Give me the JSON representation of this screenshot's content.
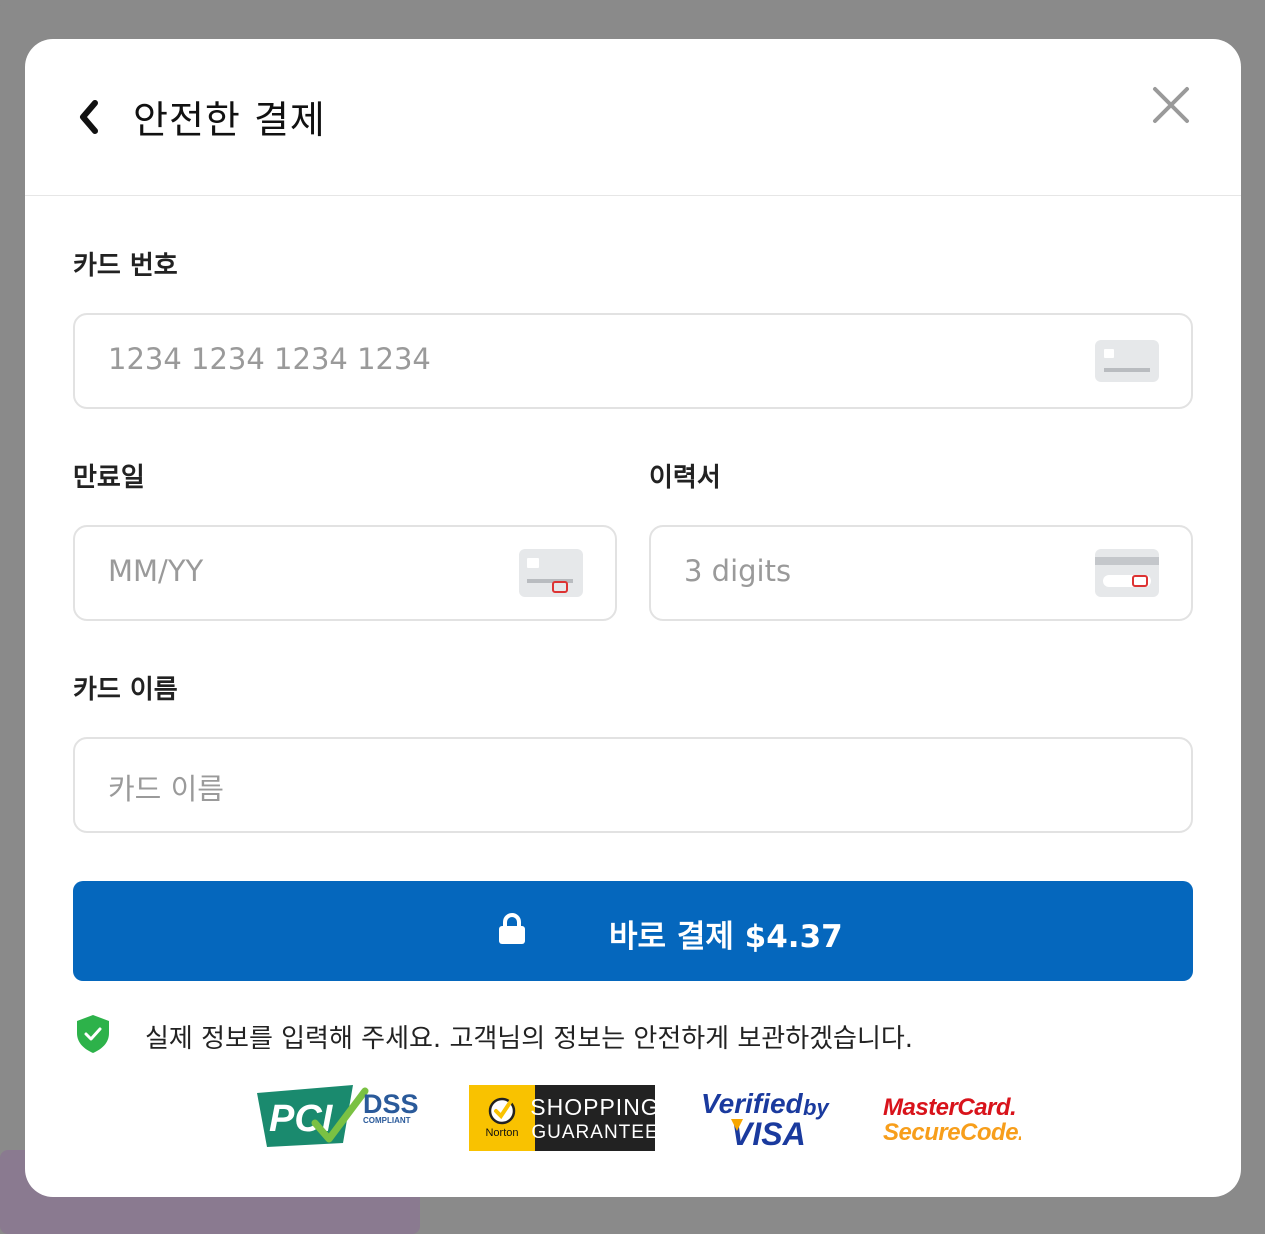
{
  "modal": {
    "title": "안전한 결제"
  },
  "form": {
    "card_number": {
      "label": "카드 번호",
      "placeholder": "1234 1234 1234 1234"
    },
    "expiry": {
      "label": "만료일",
      "placeholder": "MM/YY"
    },
    "cvc": {
      "label": "이력서",
      "placeholder": "3 digits"
    },
    "card_name": {
      "label": "카드 이름",
      "placeholder": "카드 이름"
    }
  },
  "pay_button": {
    "label": "바로 결제 $4.37"
  },
  "security_notice": "실제 정보를 입력해 주세요. 고객님의 정보는 안전하게 보관하겠습니다.",
  "badges": {
    "pci": {
      "main": "PCI",
      "dss": "DSS",
      "sub": "COMPLIANT"
    },
    "norton": {
      "brand": "Norton",
      "line1": "SHOPPING",
      "line2": "GUARANTEE"
    },
    "visa": {
      "line1": "Verified",
      "by": "by",
      "line2": "VISA"
    },
    "mastercard": {
      "line1": "MasterCard.",
      "line2": "SecureCode."
    }
  },
  "colors": {
    "primary": "#0567bd",
    "shield_green": "#2db24a",
    "pci_green": "#1a8a6e",
    "norton_yellow": "#f9c200",
    "visa_blue": "#1a3a9e",
    "mc_red": "#d8131b",
    "mc_orange": "#f79e1b"
  },
  "icons": [
    "chevron-left-icon",
    "close-icon",
    "card-icon",
    "card-back-icon",
    "lock-icon",
    "shield-check-icon"
  ]
}
